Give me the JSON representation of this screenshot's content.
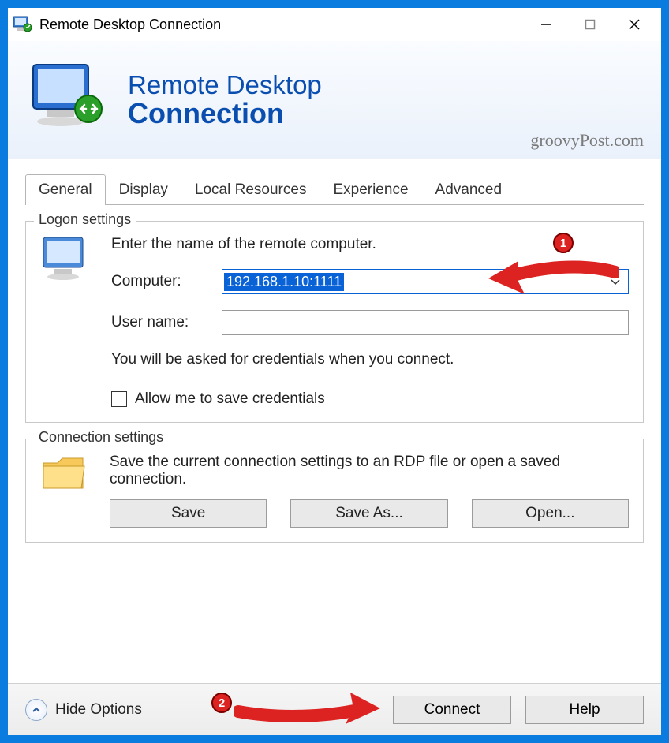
{
  "titlebar": {
    "title": "Remote Desktop Connection"
  },
  "banner": {
    "line1": "Remote Desktop",
    "line2": "Connection",
    "watermark": "groovyPost.com"
  },
  "tabs": [
    "General",
    "Display",
    "Local Resources",
    "Experience",
    "Advanced"
  ],
  "active_tab_index": 0,
  "logon": {
    "group_title": "Logon settings",
    "instruction": "Enter the name of the remote computer.",
    "computer_label": "Computer:",
    "computer_value": "192.168.1.10:1111",
    "username_label": "User name:",
    "username_value": "",
    "note": "You will be asked for credentials when you connect.",
    "checkbox_label": "Allow me to save credentials",
    "checkbox_checked": false
  },
  "connection": {
    "group_title": "Connection settings",
    "text": "Save the current connection settings to an RDP file or open a saved connection.",
    "save_label": "Save",
    "save_as_label": "Save As...",
    "open_label": "Open..."
  },
  "footer": {
    "hide_options_label": "Hide Options",
    "connect_label": "Connect",
    "help_label": "Help"
  },
  "annotations": {
    "badge1": "1",
    "badge2": "2"
  }
}
